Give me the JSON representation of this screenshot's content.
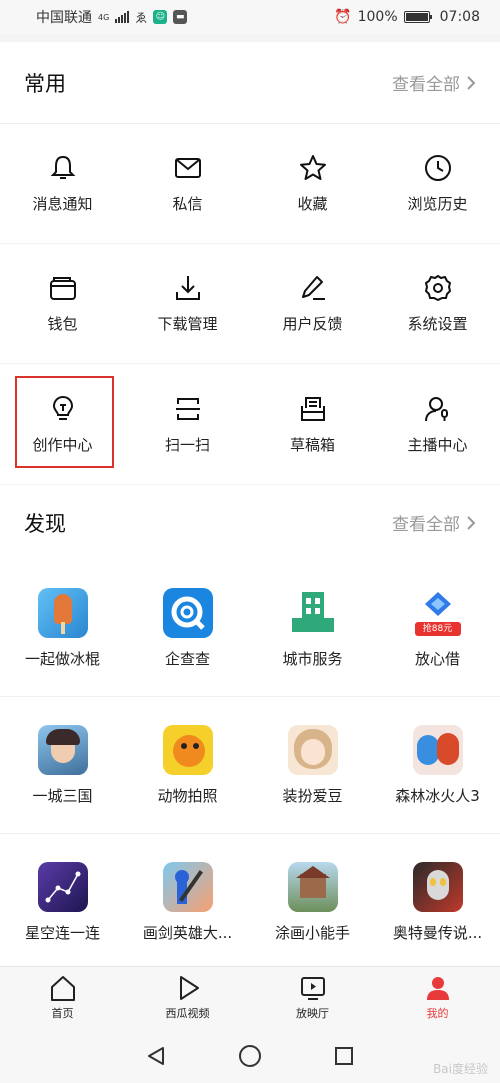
{
  "status": {
    "carrier": "中国联通",
    "net": "4G",
    "battery": "100%",
    "time": "07:08"
  },
  "common": {
    "title": "常用",
    "see_all": "查看全部",
    "items": [
      {
        "label": "消息通知",
        "icon": "bell-icon"
      },
      {
        "label": "私信",
        "icon": "mail-icon"
      },
      {
        "label": "收藏",
        "icon": "star-icon"
      },
      {
        "label": "浏览历史",
        "icon": "clock-icon"
      },
      {
        "label": "钱包",
        "icon": "wallet-icon"
      },
      {
        "label": "下载管理",
        "icon": "download-icon"
      },
      {
        "label": "用户反馈",
        "icon": "pen-icon"
      },
      {
        "label": "系统设置",
        "icon": "gear-icon"
      },
      {
        "label": "创作中心",
        "icon": "lightbulb-icon"
      },
      {
        "label": "扫一扫",
        "icon": "scan-icon"
      },
      {
        "label": "草稿箱",
        "icon": "drafts-icon"
      },
      {
        "label": "主播中心",
        "icon": "streamer-icon"
      }
    ]
  },
  "discover": {
    "title": "发现",
    "see_all": "查看全部",
    "items": [
      {
        "label": "一起做冰棍",
        "color": "#3ba3e6"
      },
      {
        "label": "企查查",
        "color": "#1a86e0"
      },
      {
        "label": "城市服务",
        "color": "#2fa87a"
      },
      {
        "label": "放心借",
        "color": "#2f7be8",
        "badge": "抢88元"
      },
      {
        "label": "一城三国",
        "color": "#6aa9d8"
      },
      {
        "label": "动物拍照",
        "color": "#f2b21c"
      },
      {
        "label": "装扮爱豆",
        "color": "#e9c9a7"
      },
      {
        "label": "森林冰火人3",
        "color": "#d94a2a"
      },
      {
        "label": "星空连一连",
        "color": "#3a2a7a"
      },
      {
        "label": "画剑英雄大...",
        "color": "#f05a4a"
      },
      {
        "label": "涂画小能手",
        "color": "#8f6b4d"
      },
      {
        "label": "奥特曼传说...",
        "color": "#c0392b"
      }
    ]
  },
  "tabs": [
    {
      "label": "首页",
      "icon": "home-icon"
    },
    {
      "label": "西瓜视频",
      "icon": "play-icon"
    },
    {
      "label": "放映厅",
      "icon": "tv-icon"
    },
    {
      "label": "我的",
      "icon": "user-icon"
    }
  ],
  "watermark": "Bai度经验",
  "colors": {
    "accent": "#e83a3a",
    "highlight": "#d9342b"
  }
}
